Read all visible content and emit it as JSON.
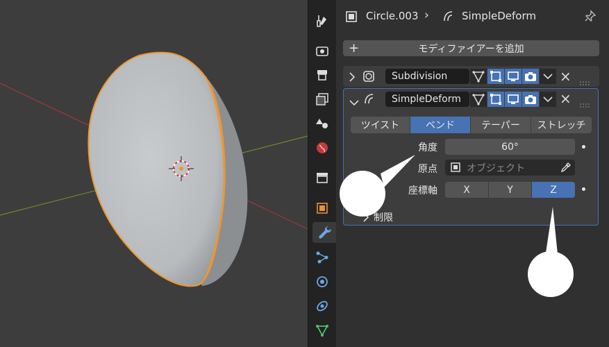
{
  "header": {
    "object_name": "Circle.003",
    "separator": "›",
    "modifier_name": "SimpleDeform"
  },
  "add_modifier": {
    "label": "モディファイアーを追加",
    "plus": "+"
  },
  "modifiers": [
    {
      "name": "Subdivision",
      "expanded": false,
      "close": "×"
    },
    {
      "name": "SimpleDeform",
      "expanded": true,
      "close": "×"
    }
  ],
  "deform_modes": [
    {
      "label": "ツイスト",
      "active": false
    },
    {
      "label": "ベンド",
      "active": true
    },
    {
      "label": "テーパー",
      "active": false
    },
    {
      "label": "ストレッチ",
      "active": false
    }
  ],
  "fields": {
    "angle_label": "角度",
    "angle_value": "60°",
    "origin_label": "原点",
    "origin_placeholder": "オブジェクト",
    "axis_label": "座標軸",
    "axes": [
      {
        "label": "X",
        "active": false
      },
      {
        "label": "Y",
        "active": false
      },
      {
        "label": "Z",
        "active": true
      }
    ],
    "restrictions_label": "制限"
  },
  "colors": {
    "accent": "#4772b3",
    "selection_outline": "#f0962d",
    "x_axis": "#a0363c",
    "y_axis": "#6e8b2a",
    "wrench": "#6ea6e6"
  },
  "icons": [
    "tool-icon",
    "render-icon",
    "output-icon",
    "view-layer-icon",
    "scene-icon",
    "world-icon",
    "collection-icon",
    "object-icon",
    "modifier-icon",
    "particles-icon",
    "physics-icon",
    "constraints-icon",
    "data-icon"
  ]
}
